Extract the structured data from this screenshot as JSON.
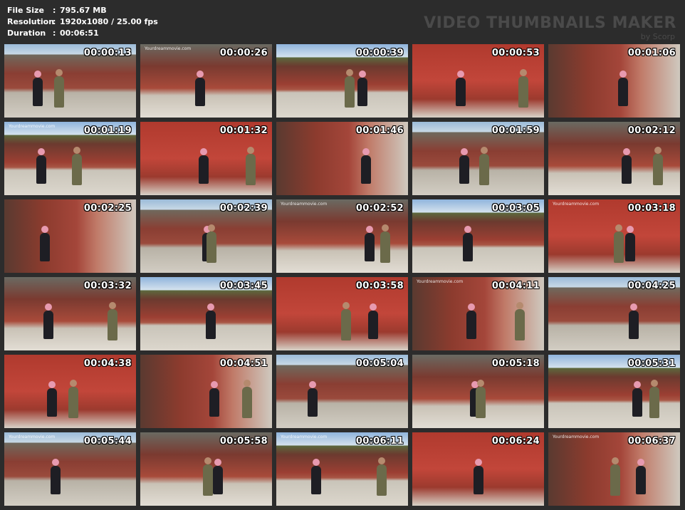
{
  "info": {
    "file_size_label": "File Size",
    "file_size_value": "795.67 MB",
    "resolution_label": "Resolution",
    "resolution_value": "1920x1080 / 25.00 fps",
    "duration_label": "Duration",
    "duration_value": "00:06:51",
    "separator": ":"
  },
  "brand": {
    "title": "VIDEO THUMBNAILS MAKER",
    "subtitle": "by Scorp"
  },
  "thumbnails": [
    {
      "time": "00:00:13",
      "watermark": ""
    },
    {
      "time": "00:00:26",
      "watermark": "Yourdreammovie.com"
    },
    {
      "time": "00:00:39",
      "watermark": ""
    },
    {
      "time": "00:00:53",
      "watermark": ""
    },
    {
      "time": "00:01:06",
      "watermark": ""
    },
    {
      "time": "00:01:19",
      "watermark": "Yourdreammovie.com"
    },
    {
      "time": "00:01:32",
      "watermark": ""
    },
    {
      "time": "00:01:46",
      "watermark": ""
    },
    {
      "time": "00:01:59",
      "watermark": ""
    },
    {
      "time": "00:02:12",
      "watermark": ""
    },
    {
      "time": "00:02:25",
      "watermark": ""
    },
    {
      "time": "00:02:39",
      "watermark": ""
    },
    {
      "time": "00:02:52",
      "watermark": "Yourdreammovie.com"
    },
    {
      "time": "00:03:05",
      "watermark": ""
    },
    {
      "time": "00:03:18",
      "watermark": "Yourdreammovie.com"
    },
    {
      "time": "00:03:32",
      "watermark": ""
    },
    {
      "time": "00:03:45",
      "watermark": ""
    },
    {
      "time": "00:03:58",
      "watermark": ""
    },
    {
      "time": "00:04:11",
      "watermark": "Yourdreammovie.com"
    },
    {
      "time": "00:04:25",
      "watermark": ""
    },
    {
      "time": "00:04:38",
      "watermark": ""
    },
    {
      "time": "00:04:51",
      "watermark": ""
    },
    {
      "time": "00:05:04",
      "watermark": ""
    },
    {
      "time": "00:05:18",
      "watermark": ""
    },
    {
      "time": "00:05:31",
      "watermark": ""
    },
    {
      "time": "00:05:44",
      "watermark": "Yourdreammovie.com"
    },
    {
      "time": "00:05:58",
      "watermark": ""
    },
    {
      "time": "00:06:11",
      "watermark": "Yourdreammovie.com"
    },
    {
      "time": "00:06:24",
      "watermark": ""
    },
    {
      "time": "00:06:37",
      "watermark": "Yourdreammovie.com"
    }
  ]
}
